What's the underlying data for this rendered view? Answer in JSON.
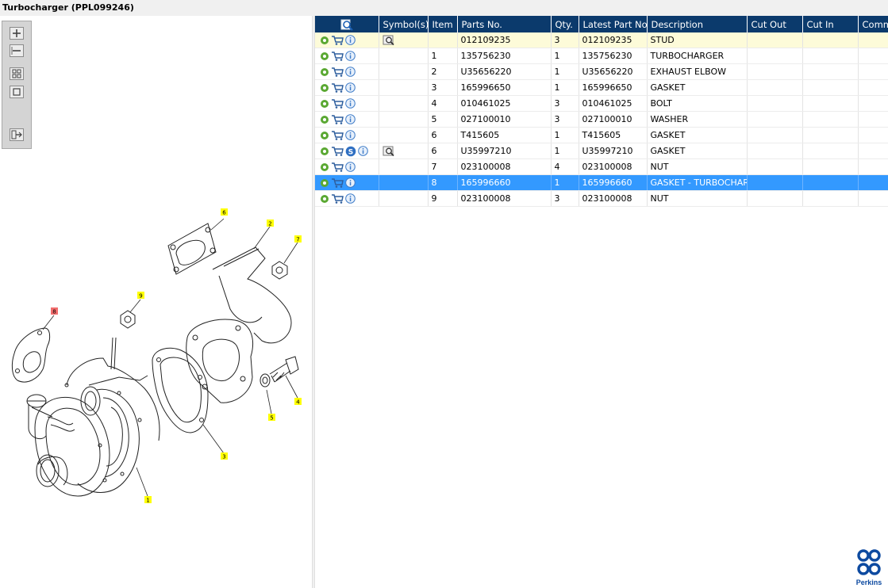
{
  "title": "Turbocharger (PPL099246)",
  "columns": [
    "",
    "Symbol(s)",
    "Item",
    "Parts No.",
    "Qty.",
    "Latest Part No.",
    "Description",
    "Cut Out",
    "Cut In",
    "Comment"
  ],
  "rows": [
    {
      "symbol": "view",
      "s": false,
      "item": "",
      "part": "012109235",
      "qty": "3",
      "latest": "012109235",
      "desc": "STUD",
      "cutout": "",
      "cutin": "",
      "comment": "",
      "state": "highlight"
    },
    {
      "symbol": "",
      "s": false,
      "item": "1",
      "part": "135756230",
      "qty": "1",
      "latest": "135756230",
      "desc": "TURBOCHARGER",
      "cutout": "",
      "cutin": "",
      "comment": "",
      "state": ""
    },
    {
      "symbol": "",
      "s": false,
      "item": "2",
      "part": "U35656220",
      "qty": "1",
      "latest": "U35656220",
      "desc": "EXHAUST ELBOW",
      "cutout": "",
      "cutin": "",
      "comment": "",
      "state": ""
    },
    {
      "symbol": "",
      "s": false,
      "item": "3",
      "part": "165996650",
      "qty": "1",
      "latest": "165996650",
      "desc": "GASKET",
      "cutout": "",
      "cutin": "",
      "comment": "",
      "state": ""
    },
    {
      "symbol": "",
      "s": false,
      "item": "4",
      "part": "010461025",
      "qty": "3",
      "latest": "010461025",
      "desc": "BOLT",
      "cutout": "",
      "cutin": "",
      "comment": "",
      "state": ""
    },
    {
      "symbol": "",
      "s": false,
      "item": "5",
      "part": "027100010",
      "qty": "3",
      "latest": "027100010",
      "desc": "WASHER",
      "cutout": "",
      "cutin": "",
      "comment": "",
      "state": ""
    },
    {
      "symbol": "",
      "s": false,
      "item": "6",
      "part": "T415605",
      "qty": "1",
      "latest": "T415605",
      "desc": "GASKET",
      "cutout": "",
      "cutin": "",
      "comment": "",
      "state": ""
    },
    {
      "symbol": "view",
      "s": true,
      "item": "6",
      "part": "U35997210",
      "qty": "1",
      "latest": "U35997210",
      "desc": "GASKET",
      "cutout": "",
      "cutin": "",
      "comment": "",
      "state": ""
    },
    {
      "symbol": "",
      "s": false,
      "item": "7",
      "part": "023100008",
      "qty": "4",
      "latest": "023100008",
      "desc": "NUT",
      "cutout": "",
      "cutin": "",
      "comment": "",
      "state": ""
    },
    {
      "symbol": "",
      "s": false,
      "item": "8",
      "part": "165996660",
      "qty": "1",
      "latest": "165996660",
      "desc": "GASKET - TURBOCHARGER",
      "cutout": "",
      "cutin": "",
      "comment": "",
      "state": "selected"
    },
    {
      "symbol": "",
      "s": false,
      "item": "9",
      "part": "023100008",
      "qty": "3",
      "latest": "023100008",
      "desc": "NUT",
      "cutout": "",
      "cutin": "",
      "comment": "",
      "state": ""
    }
  ],
  "callouts": [
    {
      "label": "1",
      "color": "#ffff00"
    },
    {
      "label": "2",
      "color": "#ffff00"
    },
    {
      "label": "3",
      "color": "#ffff00"
    },
    {
      "label": "4",
      "color": "#ffff00"
    },
    {
      "label": "5",
      "color": "#ffff00"
    },
    {
      "label": "6",
      "color": "#ffff00"
    },
    {
      "label": "7",
      "color": "#ffff00"
    },
    {
      "label": "8",
      "color": "#f26d6d"
    },
    {
      "label": "9",
      "color": "#ffff00"
    }
  ],
  "toolbar": [
    "zoom-in-icon",
    "zoom-out-icon",
    "fit-all-icon",
    "fit-window-icon",
    "export-list-icon"
  ],
  "colors": {
    "header": "#0b3a6c",
    "selected": "#3399ff",
    "highlight": "#fdfbd9",
    "gear": "#5aa832",
    "cart": "#2f5f9e",
    "info": "#3f7cc8"
  },
  "logo": {
    "text": "Perkins"
  }
}
